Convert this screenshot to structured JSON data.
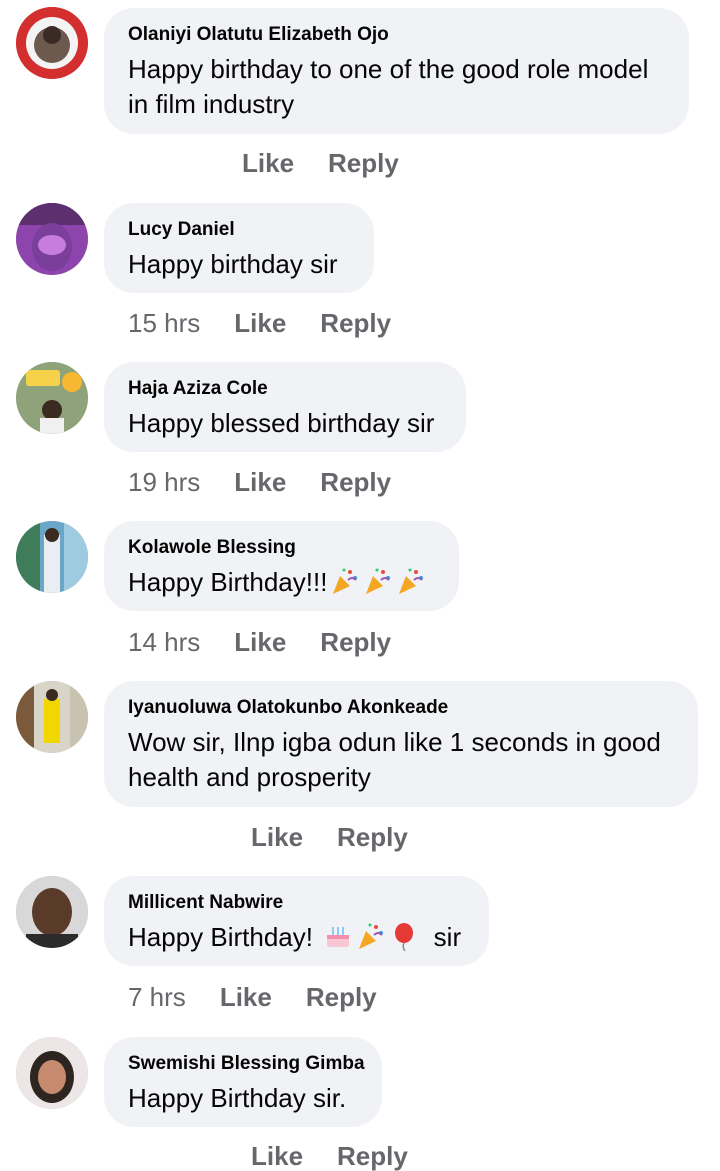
{
  "comments": [
    {
      "name": "Olaniyi Olatutu Elizabeth Ojo",
      "lines": [
        "Happy birthday to one of the good role model",
        "in film industry"
      ],
      "time": "",
      "like": "Like",
      "reply": "Reply"
    },
    {
      "name": "Lucy Daniel",
      "lines": [
        "Happy birthday  sir"
      ],
      "time": "15 hrs",
      "like": "Like",
      "reply": "Reply"
    },
    {
      "name": "Haja Aziza Cole",
      "lines": [
        "Happy blessed birthday sir"
      ],
      "time": "19 hrs",
      "like": "Like",
      "reply": "Reply"
    },
    {
      "name": "Kolawole Blessing",
      "lines": [
        "Happy Birthday!!!"
      ],
      "time": "14 hrs",
      "like": "Like",
      "reply": "Reply"
    },
    {
      "name": "Iyanuoluwa Olatokunbo Akonkeade",
      "lines": [
        "Wow sir, Ilnp igba odun like 1 seconds in good",
        "health and prosperity"
      ],
      "time": "",
      "like": "Like",
      "reply": "Reply"
    },
    {
      "name": "Millicent Nabwire",
      "lines": [
        "Happy Birthday!"
      ],
      "suffix": "sir",
      "time": "7 hrs",
      "like": "Like",
      "reply": "Reply"
    },
    {
      "name": "Swemishi Blessing Gimba",
      "lines": [
        "Happy Birthday sir."
      ],
      "time": "",
      "like": "Like",
      "reply": "Reply"
    }
  ],
  "colors": {
    "bubble": "#f0f2f5",
    "name": "#050505",
    "meta": "#65676b"
  }
}
